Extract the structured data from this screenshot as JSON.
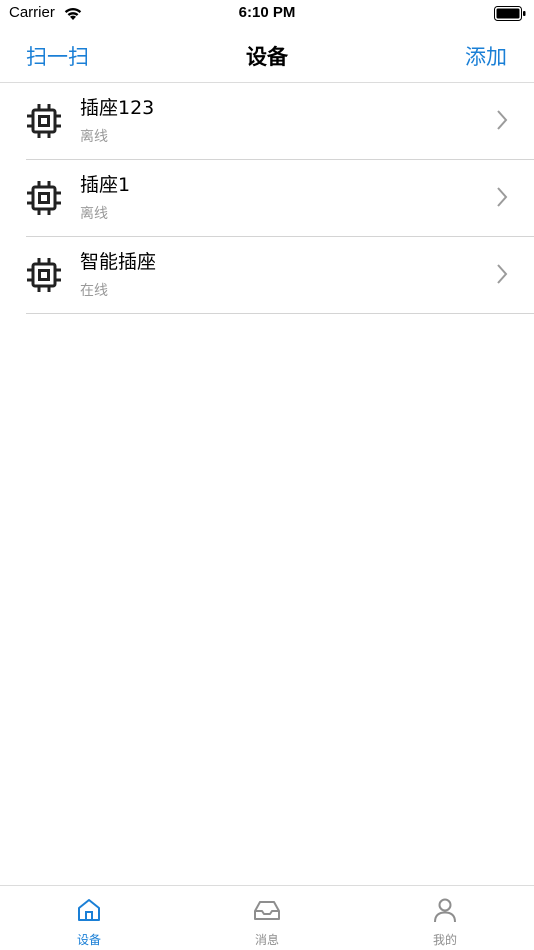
{
  "status_bar": {
    "carrier": "Carrier",
    "time": "6:10 PM"
  },
  "nav": {
    "left_label": "扫一扫",
    "title": "设备",
    "right_label": "添加"
  },
  "devices": [
    {
      "name": "插座123",
      "status": "离线",
      "icon": "chip-icon"
    },
    {
      "name": "插座1",
      "status": "离线",
      "icon": "chip-icon"
    },
    {
      "name": "智能插座",
      "status": "在线",
      "icon": "chip-icon"
    }
  ],
  "tabs": [
    {
      "label": "设备",
      "icon": "home-icon",
      "active": true
    },
    {
      "label": "消息",
      "icon": "inbox-icon",
      "active": false
    },
    {
      "label": "我的",
      "icon": "person-icon",
      "active": false
    }
  ],
  "colors": {
    "accent": "#1a7fd6",
    "secondary_text": "#9a9a9a",
    "separator": "#d4d4d4",
    "inactive_tab": "#8e8e8e"
  }
}
